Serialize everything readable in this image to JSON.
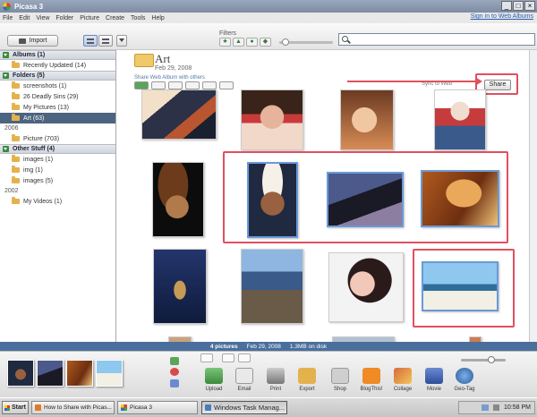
{
  "window": {
    "title": "Picasa 3",
    "min": "_",
    "max": "□",
    "close": "×"
  },
  "menu": {
    "items": [
      "File",
      "Edit",
      "View",
      "Folder",
      "Picture",
      "Create",
      "Tools",
      "Help"
    ],
    "signin": "Sign in to Web Albums"
  },
  "toolbar": {
    "import_label": "Import",
    "filters_label": "Filters",
    "filter_icons": [
      "star-icon",
      "upload-icon",
      "person-icon",
      "geo-icon"
    ],
    "search_placeholder": ""
  },
  "sidebar": {
    "albums_header": "Albums (1)",
    "albums": [
      "Recently Updated (14)"
    ],
    "folders_header": "Folders (5)",
    "folders": [
      "screenshots (1)",
      "26 Deadly Sins (29)",
      "My Pictures (13)",
      "Art (63)"
    ],
    "year_2006": "2006",
    "folders_2006": [
      "Picture (703)"
    ],
    "other_header": "Other Stuff (4)",
    "other": [
      "images (1)",
      "img (1)",
      "images (5)"
    ],
    "year_2002": "2002",
    "folders_2002": [
      "My Videos (1)"
    ]
  },
  "album": {
    "title": "Art",
    "date": "Feb 29, 2008",
    "share_text": "Share Web Album with others",
    "sync_label": "Sync to Web",
    "share_button": "Share"
  },
  "status": {
    "count": "4 pictures",
    "date": "Feb 29, 2008",
    "size": "1.3MB on disk"
  },
  "actions": [
    "Upload",
    "Email",
    "Print",
    "Export",
    "Shop",
    "BlogThis!",
    "Collage",
    "Movie",
    "Geo-Tag"
  ],
  "taskbar": {
    "start": "Start",
    "tasks": [
      "How to Share with Picas...",
      "Picasa 3",
      "Windows Task Manag..."
    ],
    "time": "10:58 PM"
  },
  "colors": {
    "selection": "#4d6480",
    "status_bar": "#4b6f9c",
    "highlight_box": "#e15060",
    "thumb_selected_border": "#6a9ad8"
  }
}
